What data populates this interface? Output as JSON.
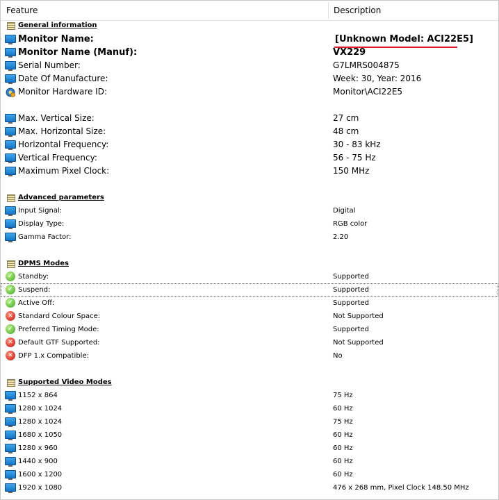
{
  "columns": {
    "feature": "Feature",
    "description": "Description"
  },
  "sections": {
    "general": "General information",
    "advanced": "Advanced parameters",
    "dpms": "DPMS Modes",
    "video": "Supported Video Modes"
  },
  "general": {
    "monitor_name": {
      "label": "Monitor Name:",
      "value": "[Unknown Model: ACI22E5]"
    },
    "monitor_name_manuf": {
      "label": "Monitor Name (Manuf):",
      "value": "VX229"
    },
    "serial": {
      "label": "Serial Number:",
      "value": "G7LMRS004875"
    },
    "manufacture_date": {
      "label": "Date Of Manufacture:",
      "value": "Week: 30, Year: 2016"
    },
    "hardware_id": {
      "label": "Monitor Hardware ID:",
      "value": "Monitor\\ACI22E5"
    },
    "v_size": {
      "label": "Max. Vertical Size:",
      "value": "27 cm"
    },
    "h_size": {
      "label": "Max. Horizontal Size:",
      "value": "48 cm"
    },
    "h_freq": {
      "label": "Horizontal Frequency:",
      "value": "30 - 83 kHz"
    },
    "v_freq": {
      "label": "Vertical Frequency:",
      "value": "56 - 75 Hz"
    },
    "pixel_clock": {
      "label": "Maximum Pixel Clock:",
      "value": "150 MHz"
    }
  },
  "advanced": {
    "input_signal": {
      "label": "Input Signal:",
      "value": "Digital"
    },
    "display_type": {
      "label": "Display Type:",
      "value": "RGB color"
    },
    "gamma": {
      "label": "Gamma Factor:",
      "value": "2.20"
    }
  },
  "dpms": {
    "standby": {
      "label": "Standby:",
      "value": "Supported",
      "status": "ok"
    },
    "suspend": {
      "label": "Suspend:",
      "value": "Supported",
      "status": "ok"
    },
    "active_off": {
      "label": "Active Off:",
      "value": "Supported",
      "status": "ok"
    },
    "std_colour": {
      "label": "Standard Colour Space:",
      "value": "Not Supported",
      "status": "error"
    },
    "pref_timing": {
      "label": "Preferred Timing Mode:",
      "value": "Supported",
      "status": "ok"
    },
    "default_gtf": {
      "label": "Default GTF Supported:",
      "value": "Not Supported",
      "status": "error"
    },
    "dfp": {
      "label": "DFP 1.x Compatible:",
      "value": "No",
      "status": "error"
    }
  },
  "video_modes": [
    {
      "mode": "1152 x 864",
      "value": "75 Hz"
    },
    {
      "mode": "1280 x 1024",
      "value": "60 Hz"
    },
    {
      "mode": "1280 x 1024",
      "value": "75 Hz"
    },
    {
      "mode": "1680 x 1050",
      "value": "60 Hz"
    },
    {
      "mode": "1280 x 960",
      "value": "60 Hz"
    },
    {
      "mode": "1440 x 900",
      "value": "60 Hz"
    },
    {
      "mode": "1600 x 1200",
      "value": "60 Hz"
    },
    {
      "mode": "1920 x 1080",
      "value": "476 x 268 mm, Pixel Clock 148.50 MHz"
    }
  ],
  "colors": {
    "highlight_underline": "#e0162b",
    "ok": "#3ea51f",
    "error": "#c4160c",
    "monitor_icon": "#1676c8"
  }
}
